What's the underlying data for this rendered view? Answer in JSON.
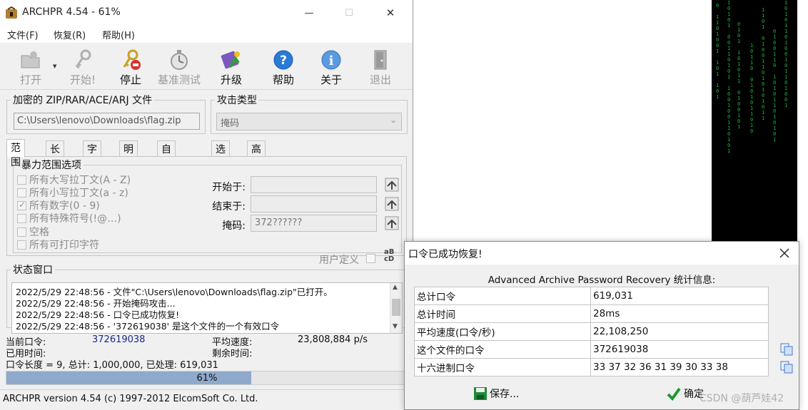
{
  "window": {
    "title": "ARCHPR 4.54 - 61%",
    "controls": {
      "minimize": "—",
      "maximize": "☐",
      "close": "✕"
    }
  },
  "menu": [
    "文件(F)",
    "恢复(R)",
    "帮助(H)"
  ],
  "toolbar": [
    {
      "label": "打开",
      "icon": "open-folder-icon",
      "enabled": false
    },
    {
      "label": "开始!",
      "icon": "keys-icon",
      "enabled": false
    },
    {
      "label": "停止",
      "icon": "stop-keys-icon",
      "enabled": true
    },
    {
      "label": "基准测试",
      "icon": "stopwatch-icon",
      "enabled": false
    },
    {
      "label": "升级",
      "icon": "upgrade-icon",
      "enabled": true
    },
    {
      "label": "帮助",
      "icon": "help-icon",
      "enabled": true
    },
    {
      "label": "关于",
      "icon": "info-icon",
      "enabled": true
    },
    {
      "label": "退出",
      "icon": "exit-door-icon",
      "enabled": false
    }
  ],
  "file_group": {
    "legend": "加密的 ZIP/RAR/ACE/ARJ 文件",
    "path": "C:\\Users\\lenovo\\Downloads\\flag.zip"
  },
  "attack_group": {
    "legend": "攻击类型",
    "value": "掩码"
  },
  "tabs": [
    "范围",
    "长度",
    "字典",
    "明文",
    "自动保存",
    "选项",
    "高级"
  ],
  "brute": {
    "legend": "暴力范围选项",
    "options": [
      {
        "label": "所有大写拉丁文(A - Z)",
        "checked": false
      },
      {
        "label": "所有小写拉丁文(a - z)",
        "checked": false
      },
      {
        "label": "所有数字(0 - 9)",
        "checked": true
      },
      {
        "label": "所有特殊符号(!@…)",
        "checked": false
      },
      {
        "label": "空格",
        "checked": false
      },
      {
        "label": "所有可打印字符",
        "checked": false
      }
    ],
    "start_label": "开始于:",
    "start_value": "",
    "end_label": "结束于:",
    "end_value": "",
    "mask_label": "掩码:",
    "mask_value": "372??????",
    "custom_label": "用户定义",
    "custom_icon_text": "aB\ncD"
  },
  "status": {
    "legend": "状态窗口",
    "log": [
      "2022/5/29 22:48:56 - 文件\"C:\\Users\\lenovo\\Downloads\\flag.zip\"已打开。",
      "2022/5/29 22:48:56 - 开始掩码攻击...",
      "2022/5/29 22:48:56 - 口令已成功恢复!",
      "2022/5/29 22:48:56 - '372619038' 是这个文件的一个有效口令"
    ]
  },
  "info": {
    "current_label": "当前口令:",
    "current_value": "372619038",
    "avg_label": "平均速度:",
    "avg_value": "23,808,884 p/s",
    "elapsed_label": "已用时间:",
    "remaining_label": "剩余时间:",
    "length_line": "口令长度 = 9, 总计: 1,000,000, 已处理: 619,031"
  },
  "progress": {
    "value": 0.61,
    "text": "61%"
  },
  "statusbar": "ARCHPR version 4.54 (c) 1997-2012 ElcomSoft Co. Ltd.",
  "dialog": {
    "title": "口令已成功恢复!",
    "heading": "Advanced Archive Password Recovery 统计信息:",
    "rows": [
      {
        "key": "总计口令",
        "value": "619,031"
      },
      {
        "key": "总计时间",
        "value": "28ms"
      },
      {
        "key": "平均速度(口令/秒)",
        "value": "22,108,250"
      },
      {
        "key": "这个文件的口令",
        "value": "372619038"
      },
      {
        "key": "十六进制口令",
        "value": "33 37 32 36 31 39 30 33 38"
      }
    ],
    "save_label": "保存...",
    "ok_label": "确定"
  },
  "watermark": "CSDN @葫芦娃42",
  "colors": {
    "accent_blue": "#1a2a8c",
    "progress_fill": "#8fa9cc",
    "matrix_green": "#1fb83a"
  }
}
